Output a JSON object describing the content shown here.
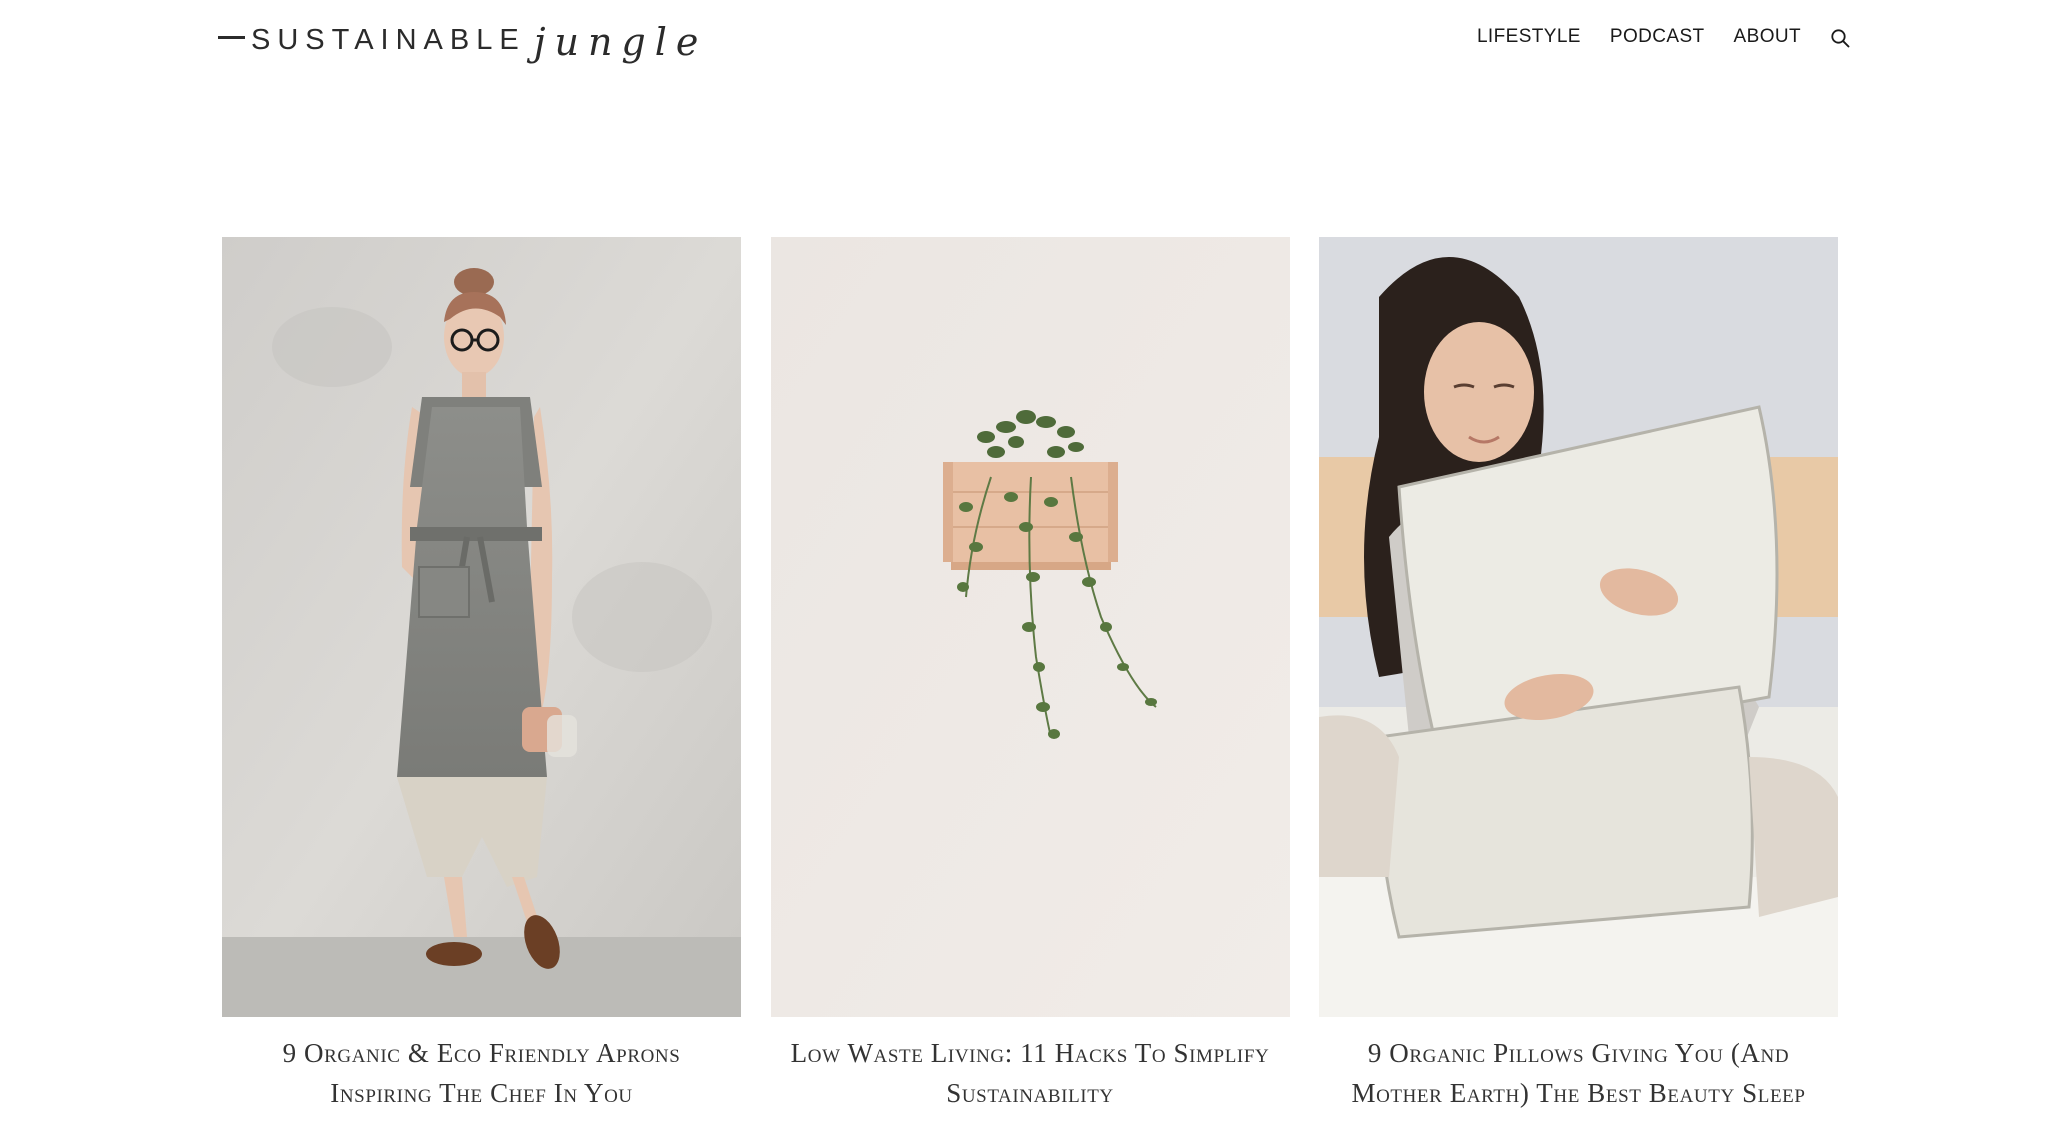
{
  "header": {
    "logo_main": "SUSTAINABLE",
    "logo_script": "jungle",
    "nav": [
      "LIFESTYLE",
      "PODCAST",
      "ABOUT"
    ]
  },
  "posts": [
    {
      "title": "9 Organic & Eco Friendly Aprons Inspiring The Chef In You"
    },
    {
      "title": "Low Waste Living: 11 Hacks To Simplify Sustainability"
    },
    {
      "title": "9 Organic Pillows Giving You (And Mother Earth) The Best Beauty Sleep"
    }
  ]
}
